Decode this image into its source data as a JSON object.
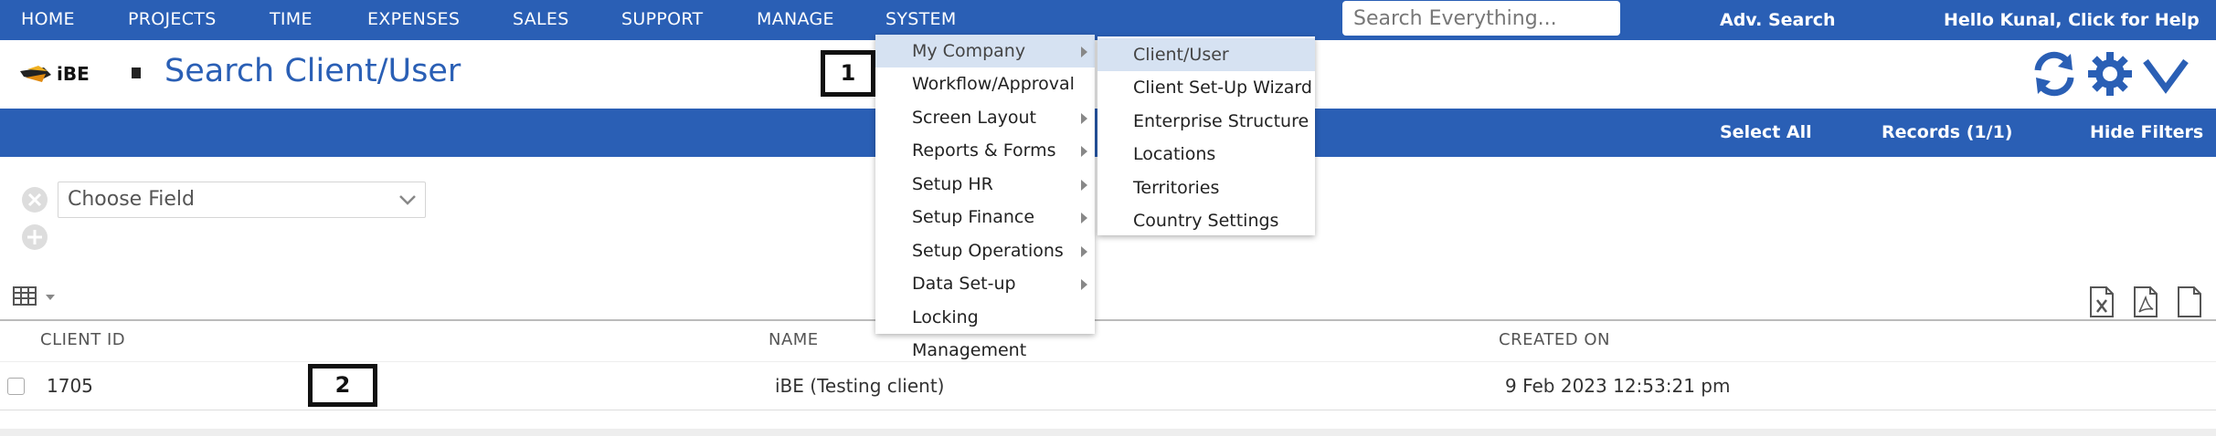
{
  "nav": {
    "items": [
      "HOME",
      "PROJECTS",
      "TIME",
      "EXPENSES",
      "SALES",
      "SUPPORT",
      "MANAGE",
      "SYSTEM"
    ],
    "search_placeholder": "Search Everything...",
    "adv_search": "Adv. Search",
    "hello": "Hello Kunal, Click for Help"
  },
  "header": {
    "logo_text": "iBE",
    "title": "Search Client/User",
    "icons": [
      "refresh-icon",
      "gear-icon",
      "chevron-down-icon"
    ]
  },
  "toolbar": {
    "select_all": "Select All",
    "records": "Records (1/1)",
    "hide_filters": "Hide Filters"
  },
  "filters": {
    "choose_field": "Choose Field"
  },
  "table": {
    "columns": [
      "CLIENT ID",
      "NAME",
      "CREATED ON"
    ],
    "rows": [
      {
        "client_id": "1705",
        "name": "iBE (Testing client)",
        "created_on": "9 Feb 2023 12:53:21 pm"
      }
    ]
  },
  "annotations": [
    "1",
    "2"
  ],
  "system_menu": {
    "items": [
      "My Company",
      "Workflow/Approval",
      "Screen Layout",
      "Reports & Forms",
      "Setup HR",
      "Setup Finance",
      "Setup Operations",
      "Data Set-up",
      "Locking Management"
    ]
  },
  "company_menu": {
    "items": [
      "Client/User",
      "Client Set-Up Wizard",
      "Enterprise Structure",
      "Locations",
      "Territories",
      "Country Settings"
    ]
  },
  "colors": {
    "brand_blue": "#2a5fb5",
    "highlight": "#d6e2f2"
  }
}
